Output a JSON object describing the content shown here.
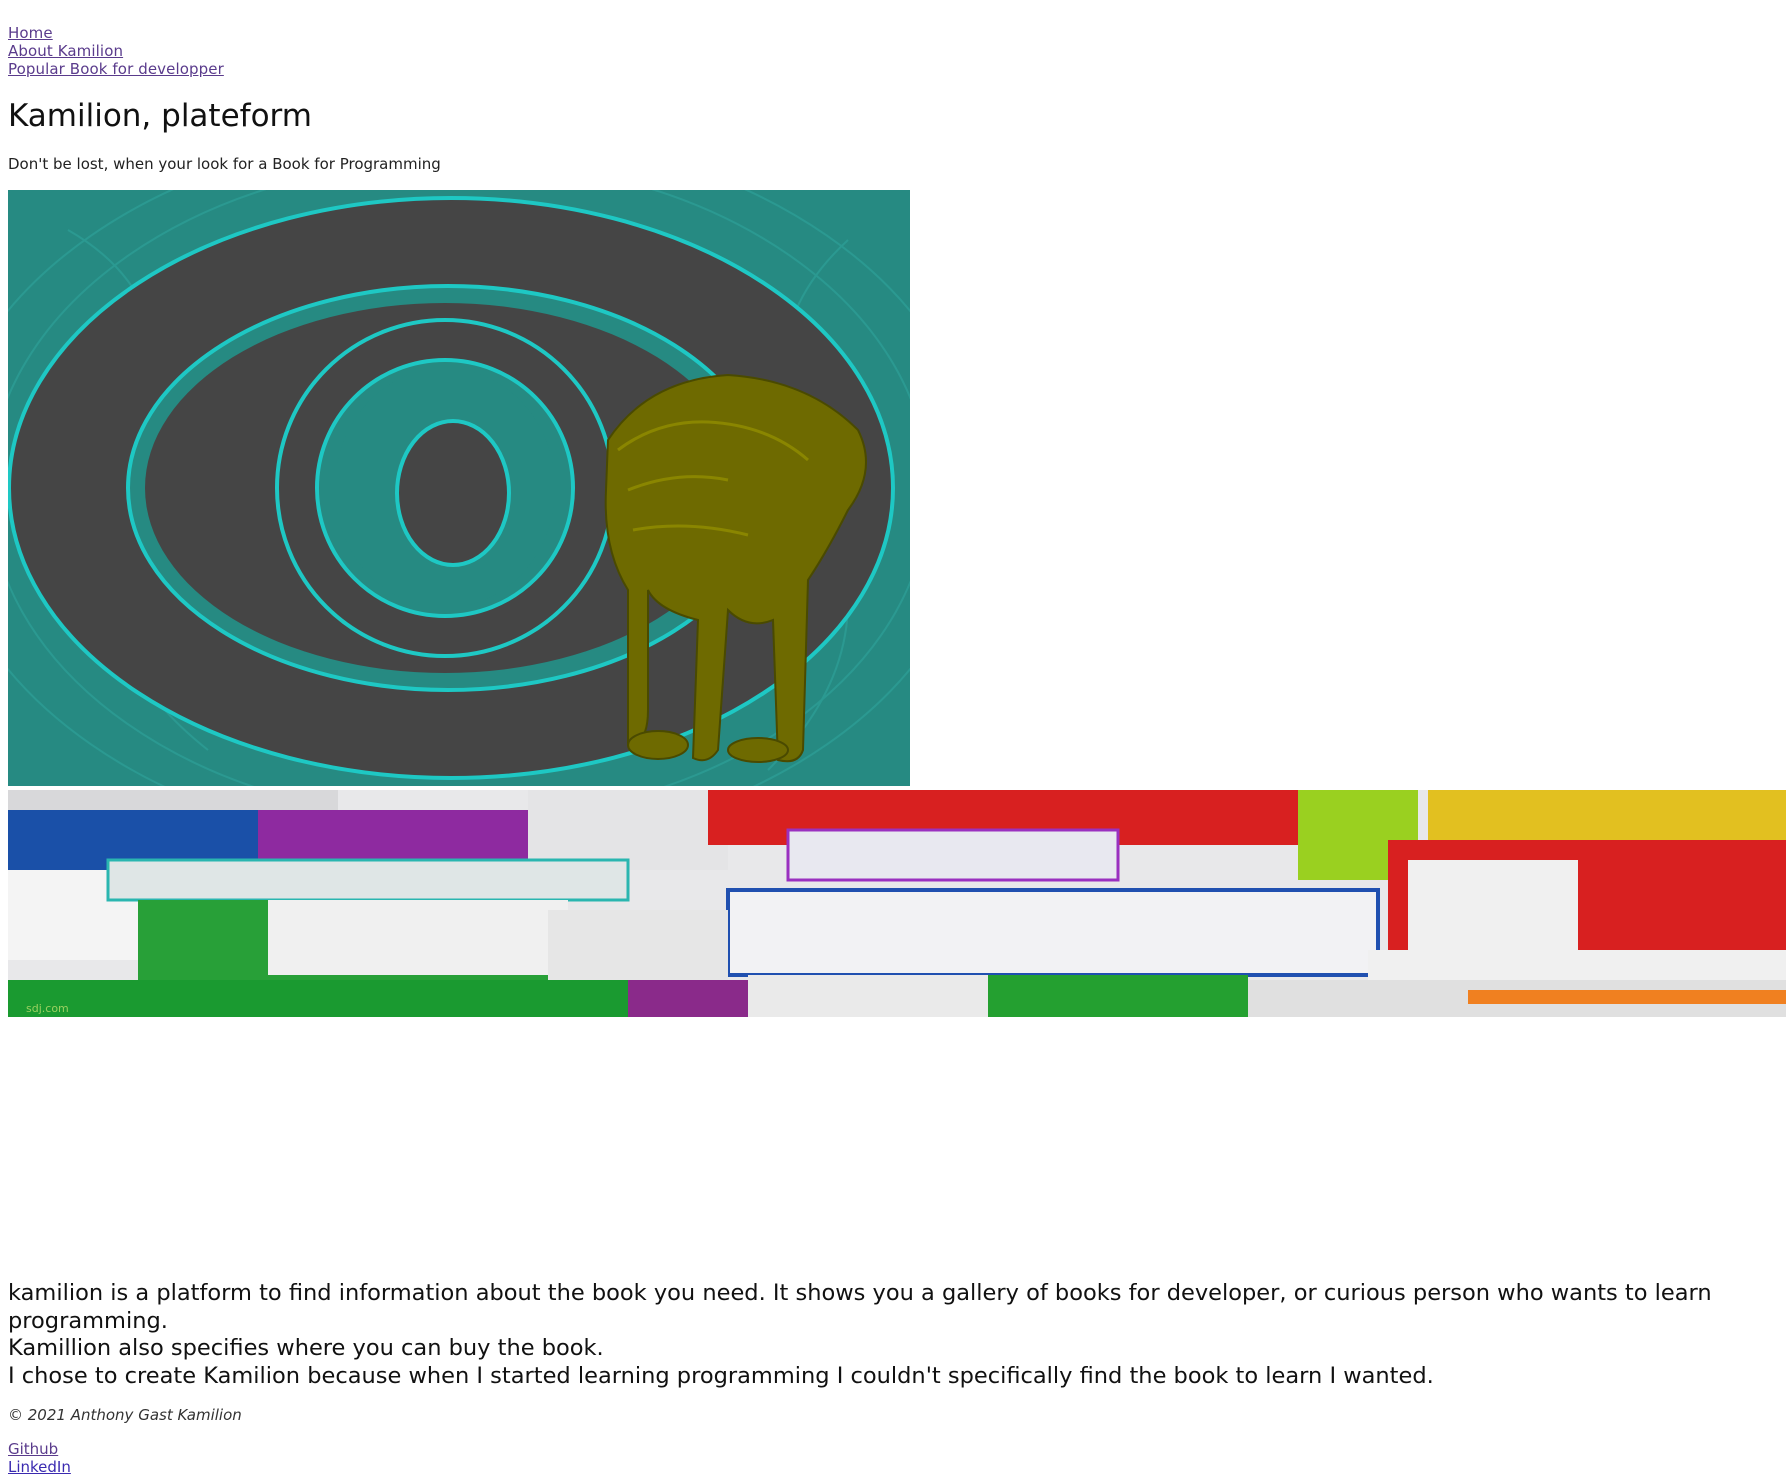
{
  "nav": {
    "items": [
      {
        "label": "Home"
      },
      {
        "label": "About Kamilion"
      },
      {
        "label": "Popular Book for developper"
      }
    ]
  },
  "header": {
    "title": "Kamilion, plateform",
    "tagline": "Don't be lost, when your look for a Book for Programming"
  },
  "images": {
    "logo": {
      "icon": "lion-target-logo",
      "colors": {
        "background": "#268a82",
        "ring": "#454545",
        "edge": "#1ec8c4",
        "lion": "#6e6a00"
      }
    },
    "banner": {
      "icon": "stacked-books-photo",
      "watermark": "sdj.com"
    }
  },
  "about": {
    "line1": "kamilion is a platform to find information about the book you need. It shows you a gallery of books for developer, or curious person who wants to learn programming.",
    "line2": "Kamillion also specifies where you can buy the book.",
    "line3": "I chose to create Kamilion because when I started learning programming I couldn't specifically find the book to learn I wanted."
  },
  "footer": {
    "copyright": "© 2021 Anthony Gast Kamilion",
    "links": [
      {
        "label": "Github"
      },
      {
        "label": "LinkedIn"
      }
    ]
  }
}
